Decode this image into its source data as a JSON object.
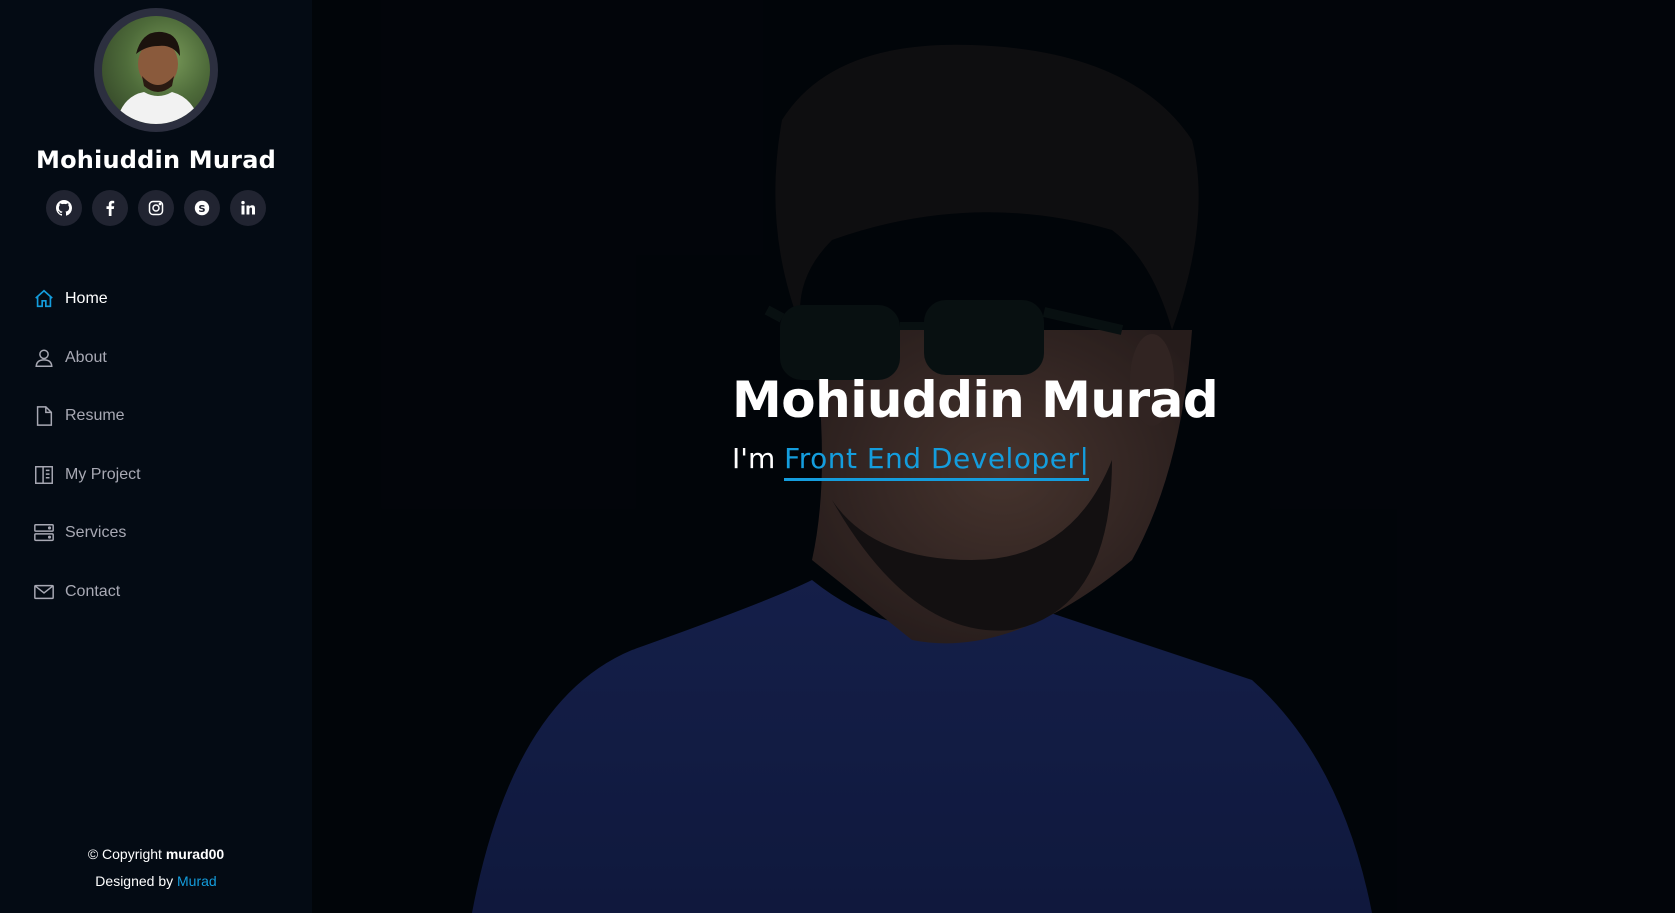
{
  "profile": {
    "name": "Mohiuddin Murad",
    "avatar_alt": ""
  },
  "social": [
    {
      "name": "github-icon"
    },
    {
      "name": "facebook-icon"
    },
    {
      "name": "instagram-icon"
    },
    {
      "name": "skype-icon"
    },
    {
      "name": "linkedin-icon"
    }
  ],
  "nav": {
    "items": [
      {
        "label": "Home",
        "icon": "home-icon",
        "active": true
      },
      {
        "label": "About",
        "icon": "person-icon",
        "active": false
      },
      {
        "label": "Resume",
        "icon": "file-icon",
        "active": false
      },
      {
        "label": "My Project",
        "icon": "book-icon",
        "active": false
      },
      {
        "label": "Services",
        "icon": "server-icon",
        "active": false
      },
      {
        "label": "Contact",
        "icon": "envelope-icon",
        "active": false
      }
    ]
  },
  "footer": {
    "copyright_prefix": "© Copyright ",
    "copyright_name": "murad00",
    "designed_prefix": "Designed by ",
    "designed_link": "Murad"
  },
  "hero": {
    "title": "Mohiuddin Murad",
    "sub_prefix": "I'm ",
    "typed_text": "Front End Developer|"
  },
  "colors": {
    "accent": "#149ddd",
    "sidebar_bg": "#040b14",
    "social_bg": "#212431",
    "nav_text": "#a8a9b4"
  }
}
